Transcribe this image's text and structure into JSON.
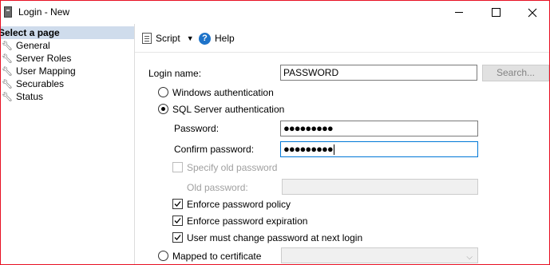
{
  "window": {
    "title": "Login - New"
  },
  "left_pane": {
    "header": "Select a page",
    "pages": [
      {
        "label": "General"
      },
      {
        "label": "Server Roles"
      },
      {
        "label": "User Mapping"
      },
      {
        "label": "Securables"
      },
      {
        "label": "Status"
      }
    ]
  },
  "toolbar": {
    "script_label": "Script",
    "help_label": "Help"
  },
  "form": {
    "login_name_label": "Login name:",
    "login_name_value": "PASSWORD",
    "search_label": "Search...",
    "windows_auth_label": "Windows authentication",
    "sql_auth_label": "SQL Server authentication",
    "auth_selected": "sql",
    "password_label": "Password:",
    "password_masked": "●●●●●●●●●",
    "confirm_password_label": "Confirm password:",
    "confirm_password_masked": "●●●●●●●●●",
    "specify_old_label": "Specify old password",
    "specify_old_checked": false,
    "old_password_label": "Old password:",
    "enforce_policy_label": "Enforce password policy",
    "enforce_policy_checked": true,
    "enforce_expiration_label": "Enforce password expiration",
    "enforce_expiration_checked": true,
    "must_change_label": "User must change password at next login",
    "must_change_checked": true,
    "mapped_cert_label": "Mapped to certificate"
  },
  "icons": {
    "page_icon": "wrench-icon",
    "script_icon": "script-icon",
    "help_icon": "help-icon"
  },
  "colors": {
    "window_border": "#e81123",
    "selected_header": "#cfdcec",
    "focus_border": "#0078d7",
    "help_blue": "#1e73c9"
  }
}
